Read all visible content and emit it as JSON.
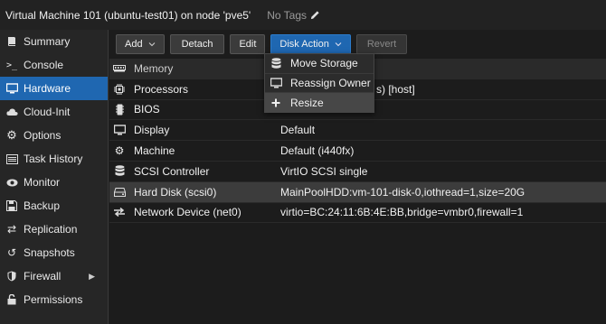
{
  "window": {
    "title": "Virtual Machine 101 (ubuntu-test01) on node 'pve5'",
    "tags": "No Tags"
  },
  "sidebar": {
    "items": [
      {
        "label": "Summary",
        "icon": "book-icon"
      },
      {
        "label": "Console",
        "icon": "terminal-icon"
      },
      {
        "label": "Hardware",
        "icon": "monitor-icon",
        "active": true
      },
      {
        "label": "Cloud-Init",
        "icon": "cloud-icon"
      },
      {
        "label": "Options",
        "icon": "gear-icon"
      },
      {
        "label": "Task History",
        "icon": "list-icon"
      },
      {
        "label": "Monitor",
        "icon": "eye-icon"
      },
      {
        "label": "Backup",
        "icon": "floppy-icon"
      },
      {
        "label": "Replication",
        "icon": "retweet-icon"
      },
      {
        "label": "Snapshots",
        "icon": "history-icon"
      },
      {
        "label": "Firewall",
        "icon": "shield-icon",
        "expandable": true
      },
      {
        "label": "Permissions",
        "icon": "unlock-icon"
      }
    ]
  },
  "toolbar": {
    "add_label": "Add",
    "detach_label": "Detach",
    "edit_label": "Edit",
    "disk_action_label": "Disk Action",
    "revert_label": "Revert"
  },
  "grid": {
    "rows": [
      {
        "name": "Memory",
        "value": "",
        "icon": "memory-icon"
      },
      {
        "name": "Processors",
        "value": "s) [host]",
        "icon": "cpu-icon"
      },
      {
        "name": "BIOS",
        "value": "",
        "icon": "chip-icon"
      },
      {
        "name": "Display",
        "value": "Default",
        "icon": "desktop-icon"
      },
      {
        "name": "Machine",
        "value": "Default (i440fx)",
        "icon": "cogs-icon"
      },
      {
        "name": "SCSI Controller",
        "value": "VirtIO SCSI single",
        "icon": "database-icon"
      },
      {
        "name": "Hard Disk (scsi0)",
        "value": "MainPoolHDD:vm-101-disk-0,iothread=1,size=20G",
        "icon": "hdd-icon",
        "selected": true
      },
      {
        "name": "Network Device (net0)",
        "value": "virtio=BC:24:11:6B:4E:BB,bridge=vmbr0,firewall=1",
        "icon": "exchange-icon"
      }
    ]
  },
  "disk_menu": {
    "items": [
      {
        "label": "Move Storage",
        "icon": "database-icon"
      },
      {
        "label": "Reassign Owner",
        "icon": "desktop-icon"
      },
      {
        "label": "Resize",
        "icon": "plus-icon",
        "hover": true
      }
    ]
  },
  "colors": {
    "accent": "#1f67b1",
    "background": "#1c1c1c"
  }
}
